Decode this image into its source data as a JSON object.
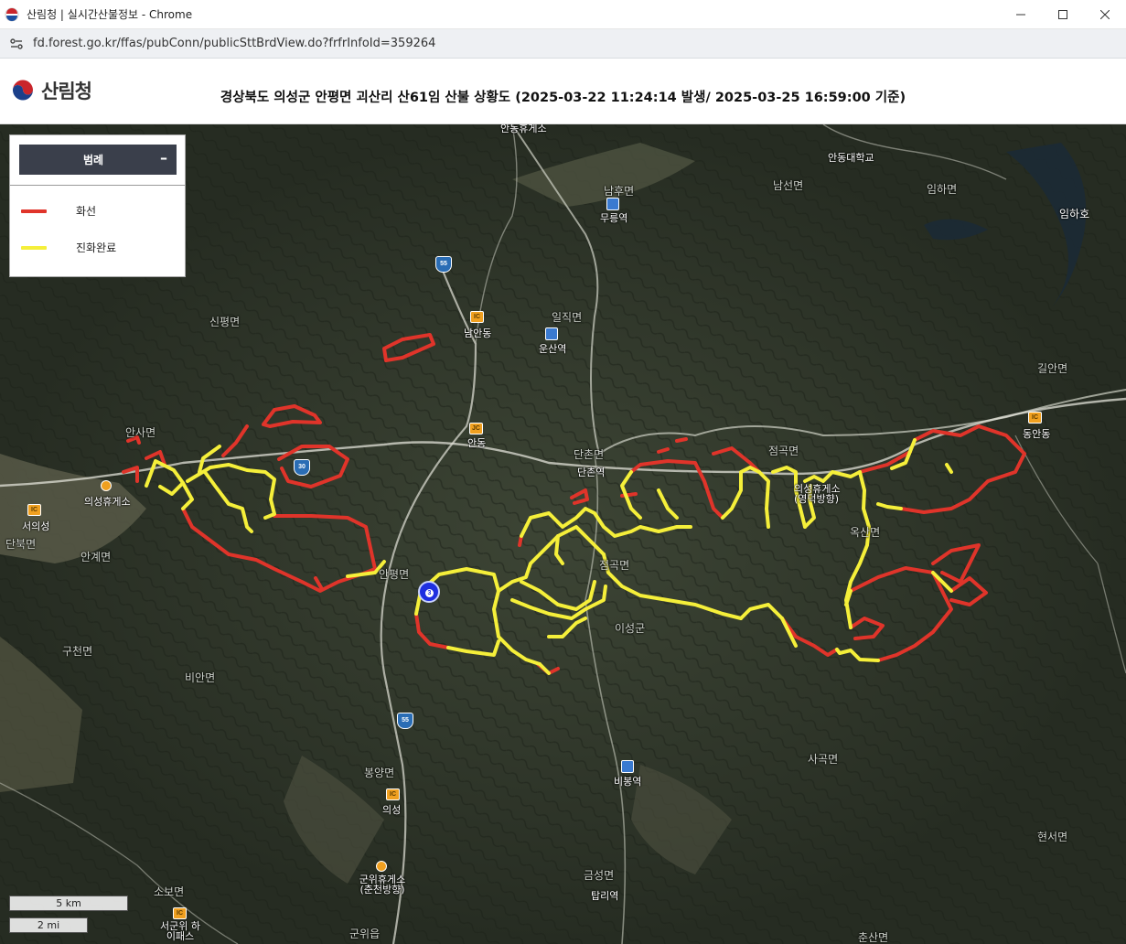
{
  "window": {
    "title": "산림청 | 실시간산불정보 - Chrome",
    "url": "fd.forest.go.kr/ffas/pubConn/publicSttBrdView.do?frfrInfoId=359264"
  },
  "header": {
    "logo_text": "산림청",
    "title": "경상북도 의성군 안평면 괴산리 산61임 산불 상황도 (2025-03-22 11:24:14 발생/ 2025-03-25 16:59:00 기준)"
  },
  "legend": {
    "title": "범례",
    "items": [
      {
        "label": "화선",
        "color": "#e0342a"
      },
      {
        "label": "진화완료",
        "color": "#f5ef3a"
      }
    ]
  },
  "scale": {
    "km": "5 km",
    "mi": "2 mi"
  },
  "map": {
    "places": [
      {
        "name": "안동휴게소",
        "icon": "rest-stop-icon"
      },
      {
        "name": "남후면",
        "icon": ""
      },
      {
        "name": "무릉역",
        "icon": "station-icon"
      },
      {
        "name": "안동대학교",
        "icon": "university-icon"
      },
      {
        "name": "남선면",
        "icon": ""
      },
      {
        "name": "임하면",
        "icon": ""
      },
      {
        "name": "임하호",
        "icon": ""
      },
      {
        "name": "남안동",
        "icon": "interchange-icon"
      },
      {
        "name": "일직면",
        "icon": ""
      },
      {
        "name": "운산역",
        "icon": "station-icon"
      },
      {
        "name": "신평면",
        "icon": ""
      },
      {
        "name": "길안면",
        "icon": ""
      },
      {
        "name": "동안동",
        "icon": "interchange-icon"
      },
      {
        "name": "안사면",
        "icon": ""
      },
      {
        "name": "안동",
        "icon": "junction-icon"
      },
      {
        "name": "단촌면",
        "icon": ""
      },
      {
        "name": "단촌역",
        "icon": "station-icon"
      },
      {
        "name": "점곡면",
        "icon": ""
      },
      {
        "name": "의성휴게소",
        "icon": "rest-stop-icon"
      },
      {
        "name": "서의성",
        "icon": "interchange-icon"
      },
      {
        "name": "단북면",
        "icon": ""
      },
      {
        "name": "안계면",
        "icon": ""
      },
      {
        "name": "안평면",
        "icon": ""
      },
      {
        "name": "의성휴게소 (영덕방향)",
        "icon": "rest-stop-icon"
      },
      {
        "name": "옥산면",
        "icon": ""
      },
      {
        "name": "점곡면",
        "icon": ""
      },
      {
        "name": "이성군",
        "icon": ""
      },
      {
        "name": "구천면",
        "icon": ""
      },
      {
        "name": "비안면",
        "icon": ""
      },
      {
        "name": "사곡면",
        "icon": ""
      },
      {
        "name": "의성",
        "icon": "interchange-icon"
      },
      {
        "name": "봉양면",
        "icon": ""
      },
      {
        "name": "비봉역",
        "icon": "station-icon"
      },
      {
        "name": "군위휴게소 (춘천방향)",
        "icon": "rest-stop-icon"
      },
      {
        "name": "소보면",
        "icon": ""
      },
      {
        "name": "서군위 하이패스",
        "icon": "interchange-icon"
      },
      {
        "name": "금성면",
        "icon": ""
      },
      {
        "name": "탑리역",
        "icon": "station-icon"
      },
      {
        "name": "현서면",
        "icon": ""
      },
      {
        "name": "군위읍",
        "icon": ""
      },
      {
        "name": "춘산면",
        "icon": ""
      },
      {
        "name": "55",
        "icon": "expressway-shield-icon"
      },
      {
        "name": "30",
        "icon": "expressway-shield-icon"
      },
      {
        "name": "55",
        "icon": "expressway-shield-icon"
      }
    ],
    "ignition_marker": {
      "label": "3",
      "icon": "fire-origin-icon"
    }
  }
}
